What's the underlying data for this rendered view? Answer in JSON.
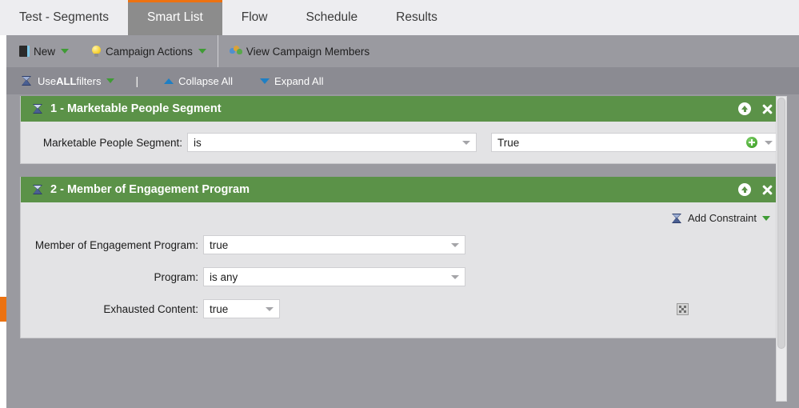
{
  "tabs": [
    {
      "label": "Test - Segments",
      "active": false
    },
    {
      "label": "Smart List",
      "active": true
    },
    {
      "label": "Flow",
      "active": false
    },
    {
      "label": "Schedule",
      "active": false
    },
    {
      "label": "Results",
      "active": false
    }
  ],
  "toolbar": {
    "new_label": "New",
    "campaign_actions_label": "Campaign Actions",
    "view_members_label": "View Campaign Members"
  },
  "filterbar": {
    "use_prefix": "Use ",
    "use_bold": "ALL",
    "use_suffix": " filters",
    "divider": "|",
    "collapse_all_label": "Collapse All",
    "expand_all_label": "Expand All"
  },
  "filters": [
    {
      "title": "1 - Marketable People Segment",
      "rows": [
        {
          "label": "Marketable People Segment:",
          "operator": "is",
          "value": "True"
        }
      ]
    },
    {
      "title": "2 - Member of Engagement Program",
      "add_constraint_label": "Add Constraint",
      "rows": [
        {
          "label": "Member of Engagement Program:",
          "value": "true"
        },
        {
          "label": "Program:",
          "value": "is any"
        },
        {
          "label": "Exhausted Content:",
          "value": "true"
        }
      ]
    }
  ],
  "colors": {
    "accent_orange": "#ec7211",
    "filter_green": "#5b9248",
    "panel_gray": "#9a9aa0",
    "card_gray": "#e3e3e5",
    "active_tab_gray": "#8c8c8c"
  }
}
